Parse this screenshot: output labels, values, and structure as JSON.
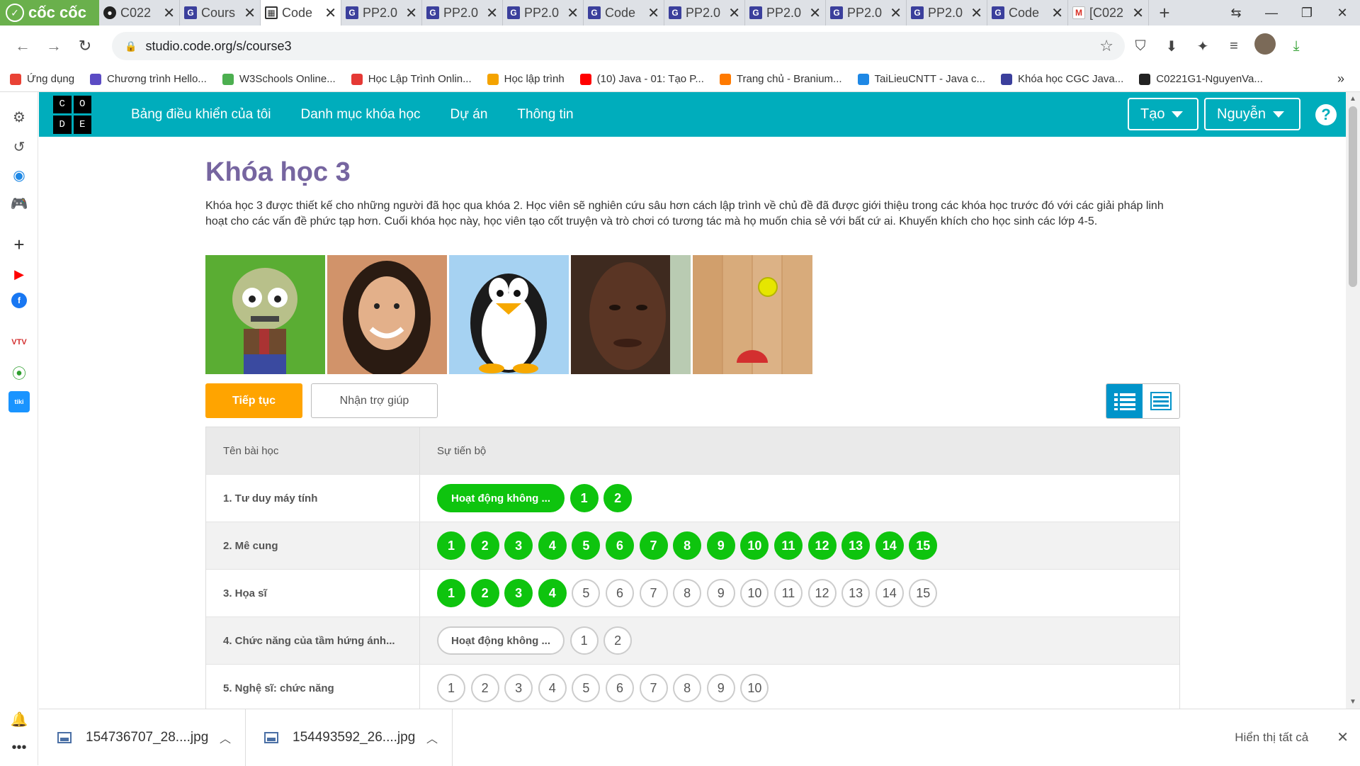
{
  "browser": {
    "brand": "cốc cốc",
    "tabs": [
      {
        "icon": "github-icon",
        "title": "C022"
      },
      {
        "icon": "codegym-icon",
        "title": "Cours"
      },
      {
        "icon": "code-org-icon",
        "title": "Code",
        "active": true
      },
      {
        "icon": "codegym-icon",
        "title": "PP2.0"
      },
      {
        "icon": "codegym-icon",
        "title": "PP2.0"
      },
      {
        "icon": "codegym-icon",
        "title": "PP2.0"
      },
      {
        "icon": "codegym-icon",
        "title": "Code"
      },
      {
        "icon": "codegym-icon",
        "title": "PP2.0"
      },
      {
        "icon": "codegym-icon",
        "title": "PP2.0"
      },
      {
        "icon": "codegym-icon",
        "title": "PP2.0"
      },
      {
        "icon": "codegym-icon",
        "title": "PP2.0"
      },
      {
        "icon": "codegym-icon",
        "title": "Code"
      },
      {
        "icon": "gmail-icon",
        "title": "[C022"
      }
    ],
    "url": "studio.code.org/s/course3",
    "bookmarks": [
      {
        "label": "Ứng dụng",
        "color": "#e94235"
      },
      {
        "label": "Chương trình Hello...",
        "color": "#5b4bc4"
      },
      {
        "label": "W3Schools Online...",
        "color": "#4caf50"
      },
      {
        "label": "Học Lập Trình Onlin...",
        "color": "#e53935"
      },
      {
        "label": "Học lập trình",
        "color": "#f4a300"
      },
      {
        "label": "(10) Java - 01: Tạo P...",
        "color": "#ff0000"
      },
      {
        "label": "Trang chủ - Branium...",
        "color": "#ff7a00"
      },
      {
        "label": "TaiLieuCNTT - Java c...",
        "color": "#1e88e5"
      },
      {
        "label": "Khóa học CGC Java...",
        "color": "#3b3f9c"
      },
      {
        "label": "C0221G1-NguyenVa...",
        "color": "#222222"
      }
    ]
  },
  "header": {
    "logo_letters": [
      "C",
      "O",
      "D",
      "E"
    ],
    "nav": [
      "Bảng điều khiển của tôi",
      "Danh mục khóa học",
      "Dự án",
      "Thông tin"
    ],
    "create_label": "Tạo",
    "user_label": "Nguyễn",
    "help_label": "?"
  },
  "course": {
    "title": "Khóa học 3",
    "description": "Khóa học 3 được thiết kế cho những người đã học qua khóa 2. Học viên sẽ nghiên cứu sâu hơn cách lập trình về chủ đề đã được giới thiệu trong các khóa học trước đó với các giải pháp linh hoạt cho các vấn đề phức tạp hơn. Cuối khóa học này, học viên tạo cốt truyện và trò chơi có tương tác mà họ muốn chia sẻ với bất cứ ai. Khuyến khích cho học sinh các lớp 4-5.",
    "images": [
      "zombie-image",
      "woman-image",
      "penguin-image",
      "man-image",
      "wood-floor-ball-image"
    ],
    "continue_label": "Tiếp tục",
    "help_label": "Nhận trợ giúp"
  },
  "table": {
    "col_lesson": "Tên bài học",
    "col_progress": "Sự tiến bộ",
    "rows": [
      {
        "name": "1. Tư duy máy tính",
        "pill": "Hoạt động không ...",
        "pill_done": true,
        "levels": 2,
        "done": 2
      },
      {
        "name": "2. Mê cung",
        "pill": null,
        "pill_done": false,
        "levels": 15,
        "done": 15
      },
      {
        "name": "3. Họa sĩ",
        "pill": null,
        "pill_done": false,
        "levels": 15,
        "done": 4
      },
      {
        "name": "4. Chức năng của tầm hứng ánh...",
        "pill": "Hoạt động không ...",
        "pill_done": false,
        "levels": 2,
        "done": 0
      },
      {
        "name": "5. Nghệ sĩ: chức năng",
        "pill": null,
        "pill_done": false,
        "levels": 10,
        "done": 0
      }
    ]
  },
  "downloads": {
    "items": [
      "154736707_28....jpg",
      "154493592_26....jpg"
    ],
    "show_all": "Hiển thị tất cả"
  },
  "colors": {
    "header_bg": "#00adbc",
    "title_purple": "#7665a0",
    "continue_orange": "#ffa400",
    "done_green": "#0ec40e",
    "toggle_blue": "#0094ca"
  }
}
